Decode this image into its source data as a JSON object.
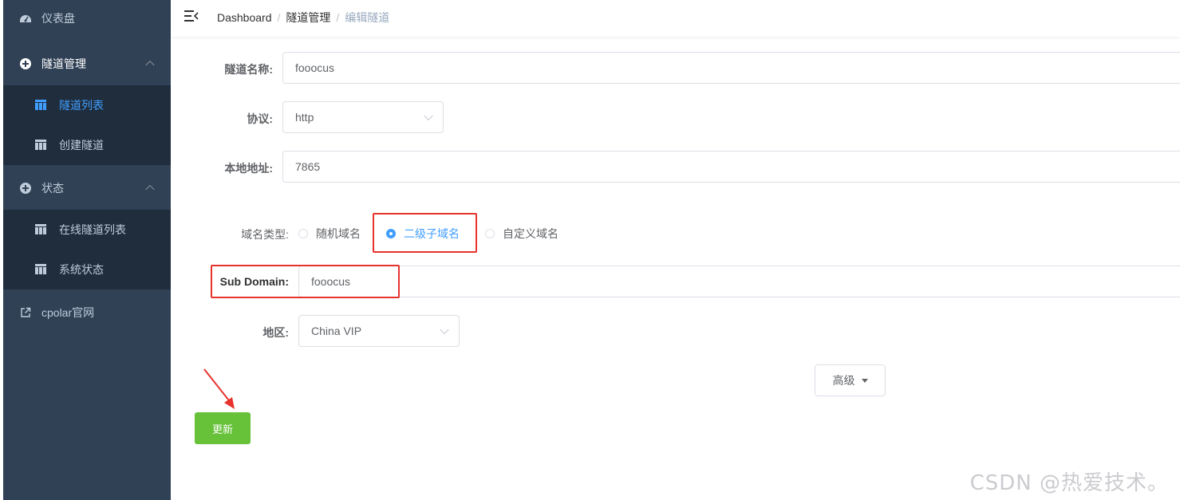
{
  "sidebar": {
    "dashboard": "仪表盘",
    "tunnel_mgmt": "隧道管理",
    "tunnel_list": "隧道列表",
    "create_tunnel": "创建隧道",
    "status": "状态",
    "online_tunnels": "在线隧道列表",
    "system_status": "系统状态",
    "cpolar_site": "cpolar官网"
  },
  "breadcrumb": {
    "home": "Dashboard",
    "section": "隧道管理",
    "current": "编辑隧道",
    "separator": "/"
  },
  "form": {
    "name_label": "隧道名称:",
    "name_value": "fooocus",
    "protocol_label": "协议:",
    "protocol_value": "http",
    "local_label": "本地地址:",
    "local_value": "7865",
    "domain_type_label": "域名类型:",
    "domain_types": [
      "随机域名",
      "二级子域名",
      "自定义域名"
    ],
    "domain_type_selected": "二级子域名",
    "subdomain_label": "Sub Domain:",
    "subdomain_value": "fooocus",
    "region_label": "地区:",
    "region_value": "China VIP",
    "advanced_label": "高级",
    "update_label": "更新"
  },
  "watermark": "CSDN @热爱技术。",
  "colors": {
    "sidebar_bg": "#304156",
    "submenu_bg": "#1f2d3d",
    "active": "#409eff",
    "update_button": "#67c23a",
    "annotation_red": "#e8322c"
  }
}
